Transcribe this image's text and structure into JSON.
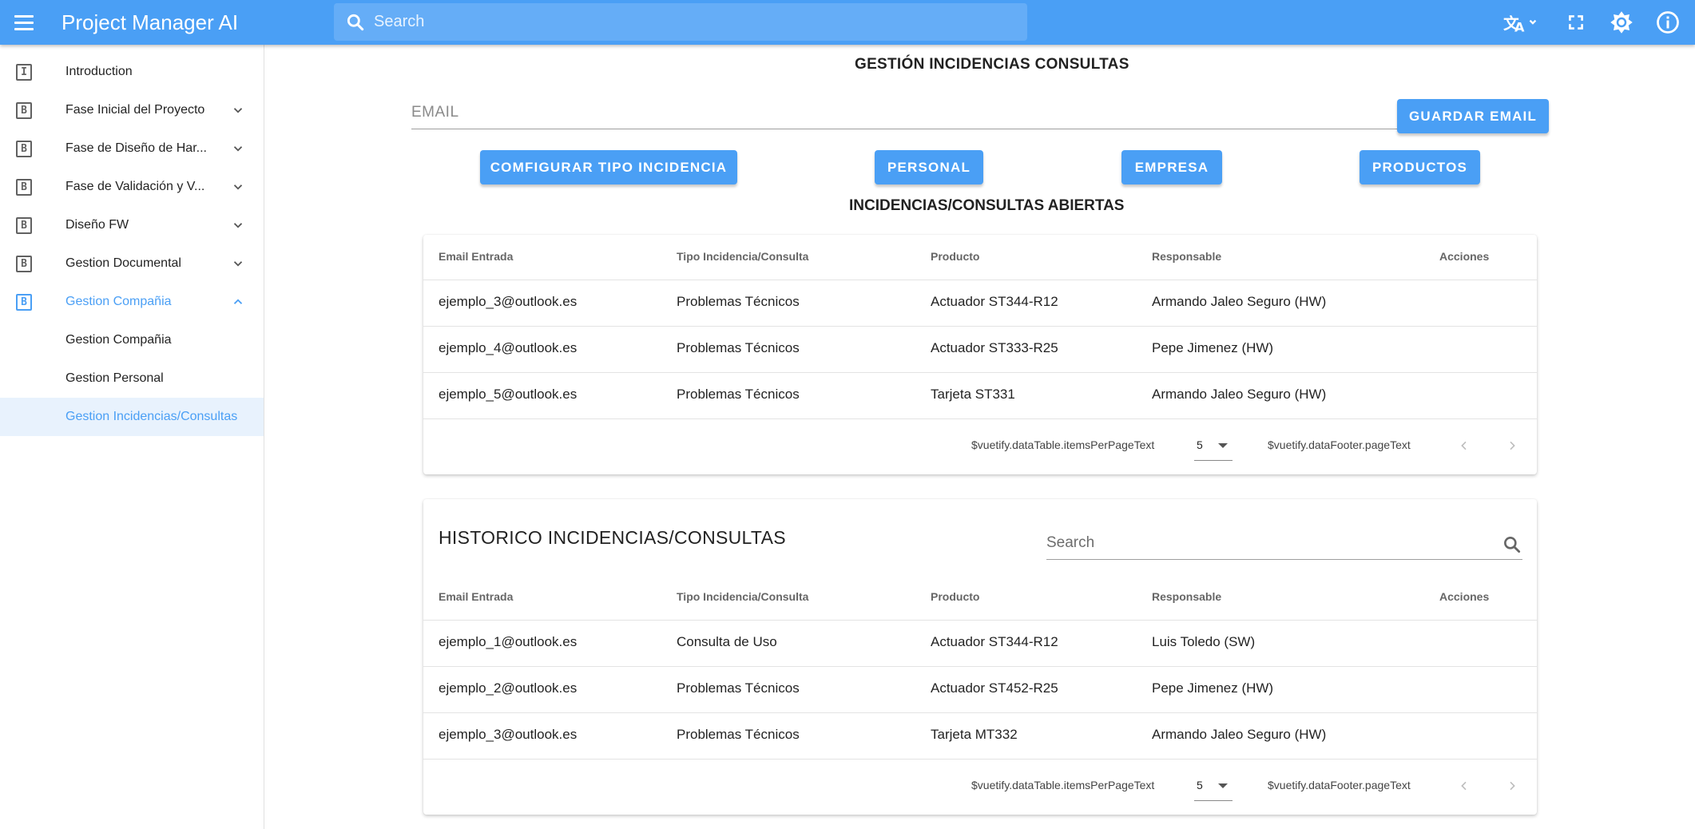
{
  "app": {
    "title": "Project Manager AI",
    "search_placeholder": "Search"
  },
  "theme": {
    "primary": "#4a9ff5",
    "selected_bg": "#e8f2fd"
  },
  "sidebar": {
    "items": [
      {
        "letter": "I",
        "label": "Introduction"
      },
      {
        "letter": "B",
        "label": "Fase Inicial del Proyecto"
      },
      {
        "letter": "B",
        "label": "Fase de Diseño de Har..."
      },
      {
        "letter": "B",
        "label": "Fase de Validación y V..."
      },
      {
        "letter": "B",
        "label": "Diseño FW"
      },
      {
        "letter": "B",
        "label": "Gestion Documental"
      },
      {
        "letter": "B",
        "label": "Gestion Compañia"
      }
    ],
    "subitems": [
      {
        "label": "Gestion Compañia"
      },
      {
        "label": "Gestion Personal"
      },
      {
        "label": "Gestion Incidencias/Consultas"
      }
    ]
  },
  "main": {
    "title": "GESTIÓN INCIDENCIAS CONSULTAS",
    "email_placeholder": "EMAIL",
    "save_email_label": "GUARDAR EMAIL",
    "buttons": {
      "config": "COMFIGURAR TIPO INCIDENCIA",
      "personal": "PERSONAL",
      "empresa": "EMPRESA",
      "productos": "PRODUCTOS"
    },
    "open_title": "INCIDENCIAS/CONSULTAS ABIERTAS"
  },
  "table_headers": [
    "Email Entrada",
    "Tipo Incidencia/Consulta",
    "Producto",
    "Responsable",
    "Acciones"
  ],
  "open_table": {
    "rows": [
      [
        "ejemplo_3@outlook.es",
        "Problemas Técnicos",
        "Actuador ST344-R12",
        "Armando Jaleo Seguro (HW)"
      ],
      [
        "ejemplo_4@outlook.es",
        "Problemas Técnicos",
        "Actuador ST333-R25",
        "Pepe Jimenez (HW)"
      ],
      [
        "ejemplo_5@outlook.es",
        "Problemas Técnicos",
        "Tarjeta ST331",
        "Armando Jaleo Seguro (HW)"
      ]
    ],
    "footer": {
      "items_per_page_text": "$vuetify.dataTable.itemsPerPageText",
      "per_page": "5",
      "page_text": "$vuetify.dataFooter.pageText"
    }
  },
  "history_table": {
    "title": "HISTORICO INCIDENCIAS/CONSULTAS",
    "search_placeholder": "Search",
    "rows": [
      [
        "ejemplo_1@outlook.es",
        "Consulta de Uso",
        "Actuador ST344-R12",
        "Luis Toledo (SW)"
      ],
      [
        "ejemplo_2@outlook.es",
        "Problemas Técnicos",
        "Actuador ST452-R25",
        "Pepe Jimenez (HW)"
      ],
      [
        "ejemplo_3@outlook.es",
        "Problemas Técnicos",
        "Tarjeta MT332",
        "Armando Jaleo Seguro (HW)"
      ]
    ],
    "footer": {
      "items_per_page_text": "$vuetify.dataTable.itemsPerPageText",
      "per_page": "5",
      "page_text": "$vuetify.dataFooter.pageText"
    }
  }
}
